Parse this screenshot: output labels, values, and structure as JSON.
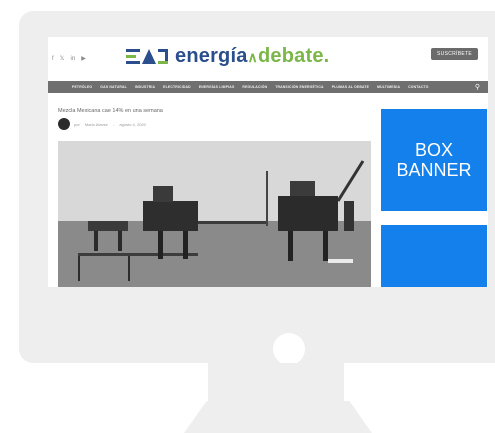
{
  "site": {
    "logo_part_a": "energía",
    "logo_part_b": "debate",
    "logo_dot": ".",
    "subscribe_label": "SUSCRÍBETE",
    "social_icons": [
      "facebook-icon",
      "twitter-icon",
      "linkedin-icon",
      "youtube-icon"
    ]
  },
  "nav": {
    "items": [
      "PETRÓLEO",
      "GAS NATURAL",
      "INDUSTRIA",
      "ELECTRICIDAD",
      "ENERGÍAS LIMPIAS",
      "REGULACIÓN",
      "TRANSICIÓN ENERGÉTICA",
      "PLUMAS AL DEBATE",
      "MULTIMEDIA",
      "CONTACTO"
    ]
  },
  "article": {
    "title": "Mezcla Mexicana cae 14% en una semana",
    "by": "por",
    "author": "Mario Alavez",
    "separator": "-",
    "date": "agosto 4, 2020"
  },
  "ads": {
    "box_banner_line1": "BOX",
    "box_banner_line2": "BANNER"
  },
  "colors": {
    "banner_blue": "#1380ec",
    "logo_blue": "#2a4f8c",
    "logo_green": "#7ab648",
    "nav_gray": "#6f6f6f",
    "monitor_gray": "#eeeeee"
  }
}
